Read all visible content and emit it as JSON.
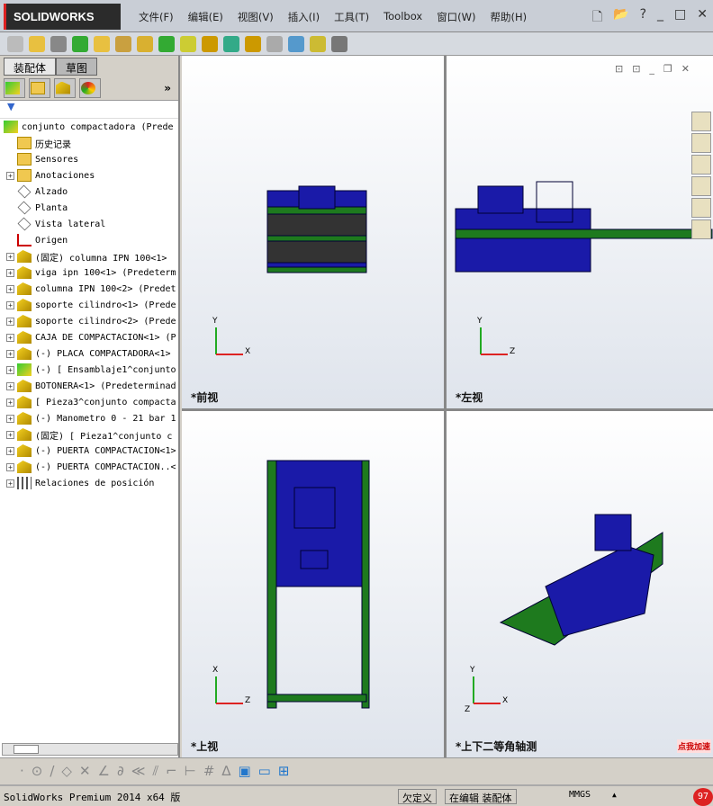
{
  "app": {
    "logo": "SOLIDWORKS"
  },
  "menu": [
    "文件(F)",
    "编辑(E)",
    "视图(V)",
    "插入(I)",
    "工具(T)",
    "Toolbox",
    "窗口(W)",
    "帮助(H)"
  ],
  "window_controls": {
    "help": "?",
    "minimize": "_",
    "restore": "□",
    "close": "✕"
  },
  "panel": {
    "tabs": [
      "装配体",
      "草图"
    ],
    "more": "»",
    "filter_icon": "funnel-icon"
  },
  "tree": [
    {
      "label": "conjunto compactadora  (Prede",
      "icon": "asm",
      "exp": false,
      "indent": 0
    },
    {
      "label": "历史记录",
      "icon": "folder",
      "exp": false,
      "indent": 1
    },
    {
      "label": "Sensores",
      "icon": "folder",
      "exp": false,
      "indent": 1
    },
    {
      "label": "Anotaciones",
      "icon": "folder",
      "exp": true,
      "indent": 1
    },
    {
      "label": "Alzado",
      "icon": "plane",
      "exp": false,
      "indent": 1
    },
    {
      "label": "Planta",
      "icon": "plane",
      "exp": false,
      "indent": 1
    },
    {
      "label": "Vista lateral",
      "icon": "plane",
      "exp": false,
      "indent": 1
    },
    {
      "label": "Origen",
      "icon": "origin",
      "exp": false,
      "indent": 1
    },
    {
      "label": "(固定) columna IPN 100<1>",
      "icon": "part",
      "exp": true,
      "indent": 1
    },
    {
      "label": "viga ipn 100<1> (Predeterm",
      "icon": "part",
      "exp": true,
      "indent": 1
    },
    {
      "label": "columna IPN 100<2> (Predet",
      "icon": "part",
      "exp": true,
      "indent": 1
    },
    {
      "label": "soporte cilindro<1> (Prede",
      "icon": "part",
      "exp": true,
      "indent": 1
    },
    {
      "label": "soporte cilindro<2> (Prede",
      "icon": "part",
      "exp": true,
      "indent": 1
    },
    {
      "label": "CAJA DE COMPACTACION<1> (P",
      "icon": "part",
      "exp": true,
      "indent": 1
    },
    {
      "label": "(-) PLACA COMPACTADORA<1>",
      "icon": "part",
      "exp": true,
      "indent": 1
    },
    {
      "label": "(-) [ Ensamblaje1^conjunto",
      "icon": "asm",
      "exp": true,
      "indent": 1
    },
    {
      "label": "BOTONERA<1> (Predeterminad",
      "icon": "part",
      "exp": true,
      "indent": 1
    },
    {
      "label": "[ Pieza3^conjunto compacta",
      "icon": "part",
      "exp": true,
      "indent": 1
    },
    {
      "label": "(-) Manometro 0 - 21 bar 1",
      "icon": "part",
      "exp": true,
      "indent": 1
    },
    {
      "label": "(固定) [ Pieza1^conjunto c",
      "icon": "part",
      "exp": true,
      "indent": 1
    },
    {
      "label": "(-) PUERTA COMPACTACION<1>",
      "icon": "part",
      "exp": true,
      "indent": 1
    },
    {
      "label": "(-) PUERTA COMPACTACION..<",
      "icon": "part",
      "exp": true,
      "indent": 1
    },
    {
      "label": "Relaciones de posición",
      "icon": "mate",
      "exp": true,
      "indent": 1
    }
  ],
  "viewports": [
    {
      "label": "*前视",
      "axes": [
        "Y",
        "X"
      ]
    },
    {
      "label": "*左视",
      "axes": [
        "Y",
        "Z"
      ]
    },
    {
      "label": "*上视",
      "axes": [
        "X",
        "Z"
      ]
    },
    {
      "label": "*上下二等角轴测",
      "axes": [
        "Y",
        "X",
        "Z"
      ]
    }
  ],
  "status": {
    "product": "SolidWorks Premium 2014 x64 版",
    "definition": "欠定义",
    "mode": "在编辑 装配体",
    "units": "MMGS",
    "units_arrow": "▲",
    "badge": "点我加速",
    "badge_num": "97"
  },
  "colors": {
    "model_blue": "#1a1aa8",
    "frame_green": "#1e7a1e",
    "logo_bg": "#2b2b2b"
  }
}
